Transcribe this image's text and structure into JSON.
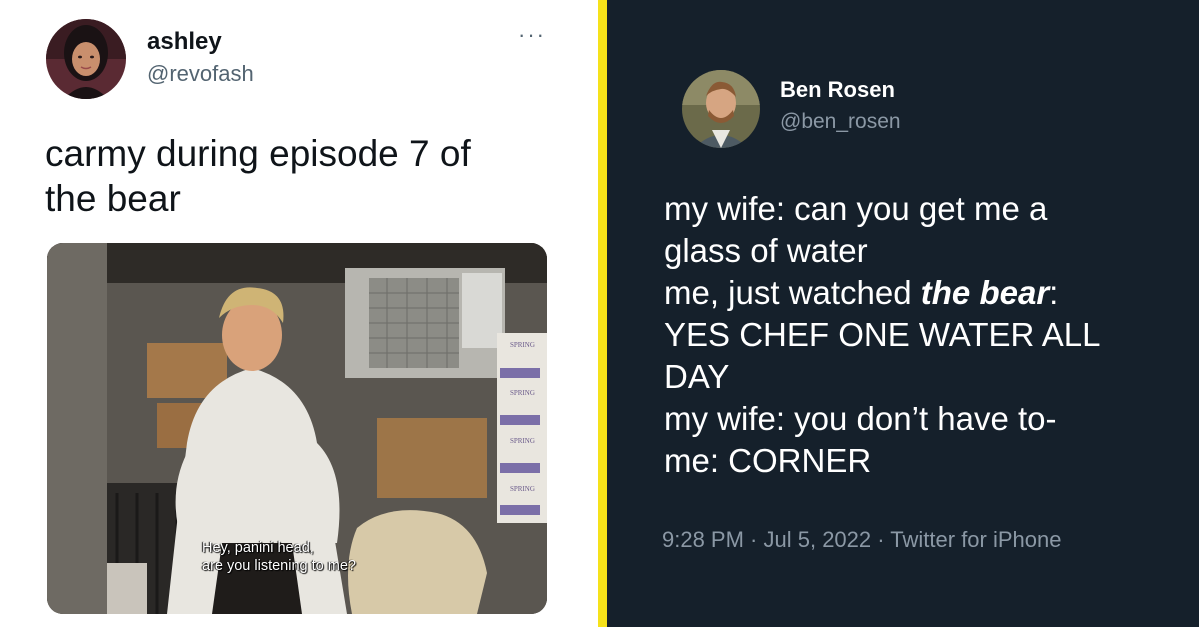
{
  "left_tweet": {
    "name": "ashley",
    "handle": "@revofash",
    "more": "···",
    "text_line1": "carmy during episode 7 of",
    "text_line2": "the bear",
    "media": {
      "caption_line1": "Hey, panini head,",
      "caption_line2": "are you listening to me?",
      "box_label": "SPRING"
    }
  },
  "right_tweet": {
    "name": "Ben Rosen",
    "handle": "@ben_rosen",
    "lines": [
      "my wife: can you get me a",
      "glass of water",
      "me, just watched ",
      "the bear",
      ":",
      "YES CHEF ONE WATER ALL",
      "DAY",
      "my wife: you don’t have to-",
      "me: CORNER"
    ],
    "time": "9:28 PM",
    "sep": " · ",
    "date": "Jul 5, 2022",
    "source": "Twitter for iPhone"
  },
  "colors": {
    "dark_bg": "#15202b",
    "divider": "#f6e21a",
    "secondary_text": "#536471",
    "dark_secondary_text": "#8b98a5"
  }
}
